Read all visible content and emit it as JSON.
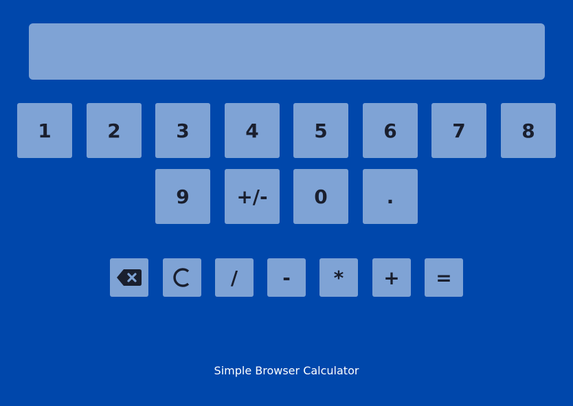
{
  "display": {
    "value": ""
  },
  "keypad": {
    "digit_1": "1",
    "digit_2": "2",
    "digit_3": "3",
    "digit_4": "4",
    "digit_5": "5",
    "digit_6": "6",
    "digit_7": "7",
    "digit_8": "8",
    "digit_9": "9",
    "plus_minus": "+/-",
    "digit_0": "0",
    "decimal": "."
  },
  "operators": {
    "backspace_icon": "backspace-icon",
    "clear_icon": "clear-icon",
    "divide": "/",
    "subtract": "-",
    "multiply": "*",
    "add": "+",
    "equals": "="
  },
  "footer": {
    "text": "Simple Browser Calculator"
  },
  "colors": {
    "background": "#0047ab",
    "key": "#7fa3d5",
    "key_text": "#1a1f2e",
    "footer_text": "#ffffff"
  }
}
